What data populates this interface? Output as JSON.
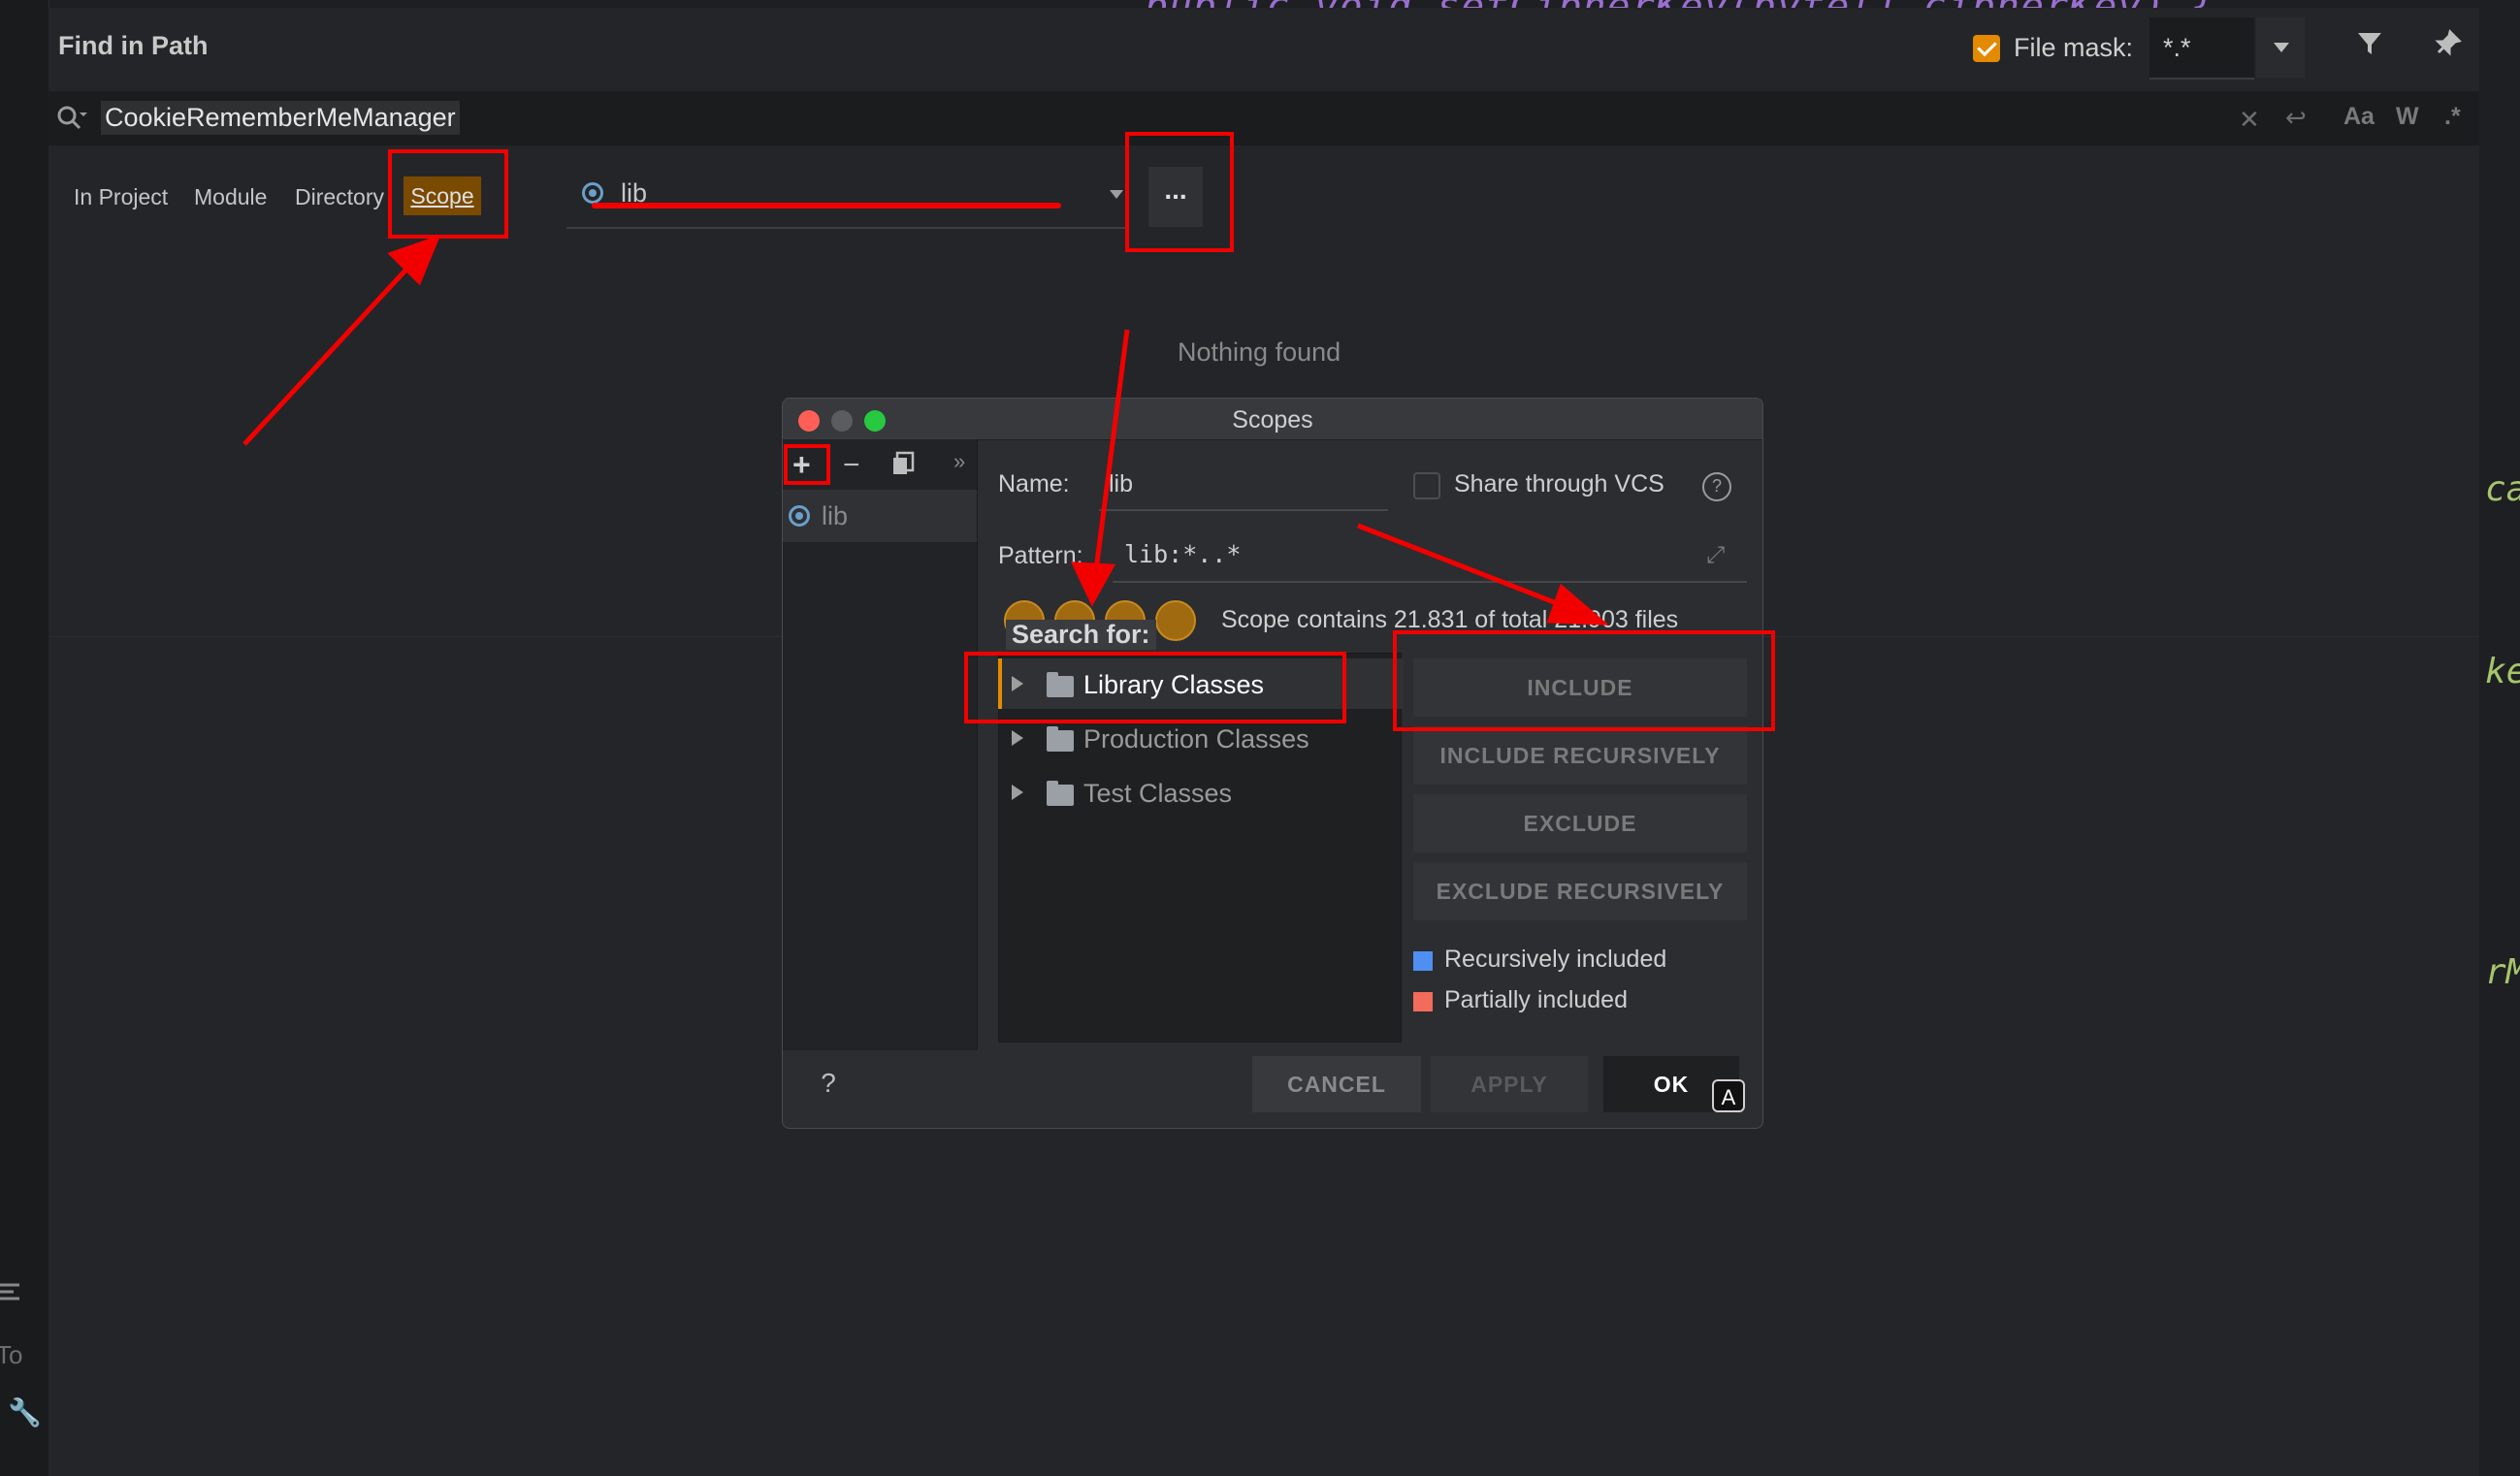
{
  "editor": {
    "code_line": "public void setCipherKey(byte[] cipherKey) {",
    "right_fragments": [
      "ca",
      "ke",
      "rM"
    ],
    "bottom_left_text": "To"
  },
  "find_in_path": {
    "title": "Find in Path",
    "search_query": "CookieRememberMeManager",
    "file_mask_label": "File mask:",
    "file_mask_value": "*.*",
    "file_mask_checked": true,
    "option_icons": {
      "match_case": "Aa",
      "words": "W",
      "regex": ".*"
    },
    "scope_tabs": [
      "In Project",
      "Module",
      "Directory",
      "Scope"
    ],
    "active_scope_tab": "Scope",
    "scope_value": "lib",
    "more_button": "...",
    "results_message": "Nothing found"
  },
  "scopes_dialog": {
    "title": "Scopes",
    "scopes_list": [
      "lib"
    ],
    "name_label": "Name:",
    "name_value": "lib",
    "share_label": "Share through VCS",
    "share_checked": false,
    "pattern_label": "Pattern:",
    "pattern_value": "lib:*..*",
    "scope_summary": "Scope contains 21.831 of total 21.903 files",
    "search_for_label": "Search for:",
    "tree_items": [
      "Library Classes",
      "Production Classes",
      "Test Classes"
    ],
    "selected_tree_item": "Library Classes",
    "buttons": {
      "include": "INCLUDE",
      "include_recursively": "INCLUDE RECURSIVELY",
      "exclude": "EXCLUDE",
      "exclude_recursively": "EXCLUDE RECURSIVELY",
      "cancel": "CANCEL",
      "apply": "APPLY",
      "ok": "OK",
      "help": "?"
    },
    "legend": [
      {
        "label": "Recursively included",
        "color": "#4f8ff2"
      },
      {
        "label": "Partially included",
        "color": "#f26b5b"
      }
    ],
    "ok_badge": "A"
  },
  "colors": {
    "accent_orange": "#e38a00",
    "annotation_red": "#f20000"
  }
}
